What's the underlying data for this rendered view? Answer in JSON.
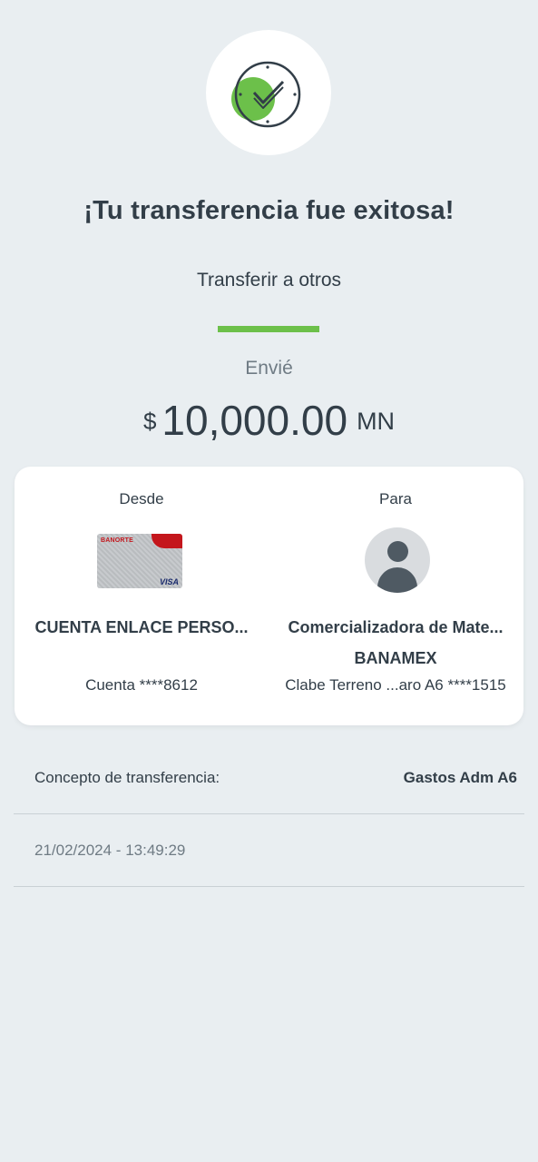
{
  "header": {
    "title": "¡Tu transferencia fue exitosa!",
    "operation_type": "Transferir a otros"
  },
  "amount": {
    "label": "Envié",
    "currency_symbol": "$",
    "value": "10,000.00",
    "currency_code": "MN"
  },
  "from": {
    "label": "Desde",
    "card_brand": "BANORTE",
    "card_network": "VISA",
    "account_name": "CUENTA ENLACE PERSO...",
    "account_number": "Cuenta ****8612"
  },
  "to": {
    "label": "Para",
    "recipient_name": "Comercializadora de Mate...",
    "bank": "BANAMEX",
    "account_number": "Clabe Terreno ...aro A6 ****1515"
  },
  "details": {
    "concept_label": "Concepto de transferencia:",
    "concept_value": "Gastos Adm A6",
    "datetime": "21/02/2024 - 13:49:29"
  },
  "colors": {
    "accent": "#6CC04A",
    "background": "#E9EEF1",
    "text": "#323E48",
    "bank_red": "#C4161C"
  },
  "icons": {
    "success": "check-clock-icon",
    "recipient": "user-avatar-icon"
  }
}
